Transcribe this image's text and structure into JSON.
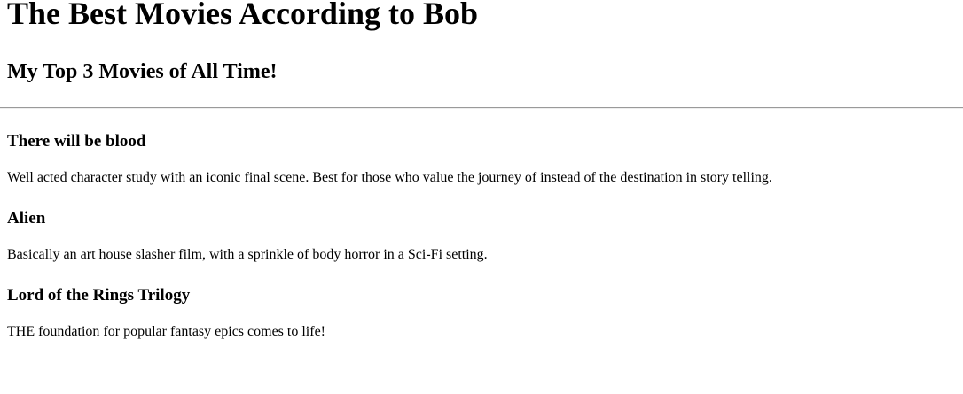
{
  "page": {
    "title": "The Best Movies According to Bob",
    "subtitle": "My Top 3 Movies of All Time!"
  },
  "movies": [
    {
      "title": "There will be blood",
      "description": "Well acted character study with an iconic final scene. Best for those who value the journey of instead of the destination in story telling."
    },
    {
      "title": "Alien",
      "description": "Basically an art house slasher film, with a sprinkle of body horror in a Sci-Fi setting."
    },
    {
      "title": "Lord of the Rings Trilogy",
      "description": "THE foundation for popular fantasy epics comes to life!"
    }
  ]
}
